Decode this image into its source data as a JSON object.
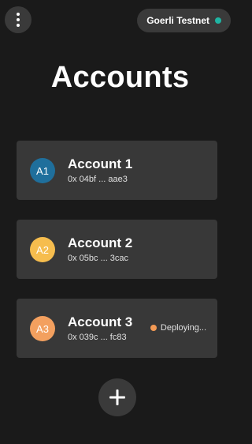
{
  "header": {
    "menu_icon": "more-vertical-icon",
    "network": {
      "label": "Goerli Testnet",
      "status_color": "#1fb5a3"
    }
  },
  "title": "Accounts",
  "accounts": [
    {
      "avatar_text": "A1",
      "avatar_color": "#1f6f9c",
      "name": "Account 1",
      "address": "0x 04bf ... aae3"
    },
    {
      "avatar_text": "A2",
      "avatar_color": "#f6bd4e",
      "name": "Account 2",
      "address": "0x 05bc ... 3cac"
    },
    {
      "avatar_text": "A3",
      "avatar_color": "#f3a05f",
      "name": "Account 3",
      "address": "0x 039c ... fc83",
      "status": {
        "label": "Deploying...",
        "color": "#f39a55"
      }
    }
  ],
  "add_button": {
    "icon": "plus-icon"
  }
}
